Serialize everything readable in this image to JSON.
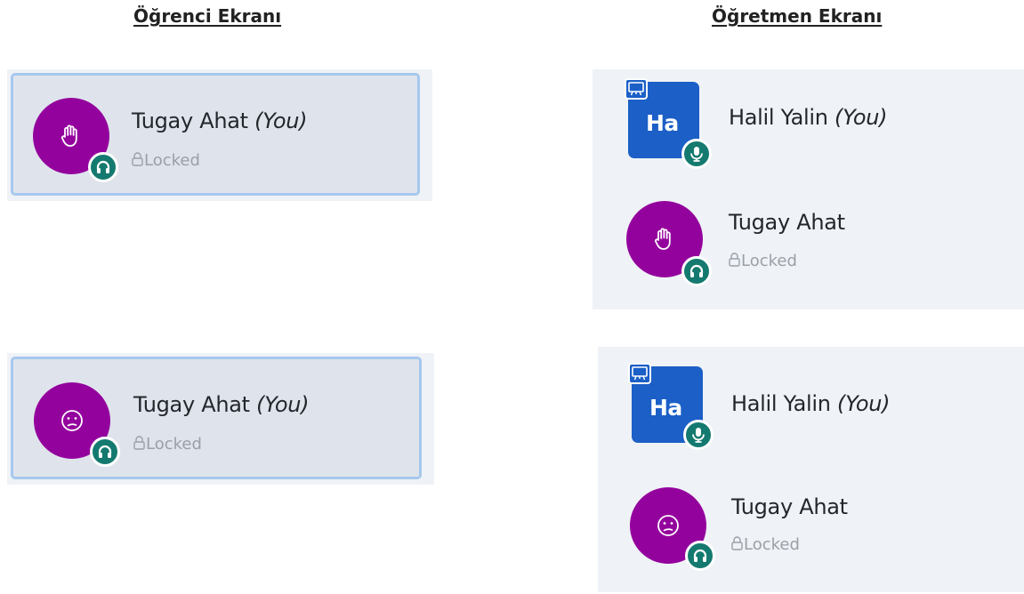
{
  "headings": {
    "student": "Öğrenci Ekranı",
    "teacher": "Öğretmen Ekranı"
  },
  "student_view": {
    "cards": [
      {
        "name": "Tugay Ahat",
        "you_tag": "(You)",
        "status": "Locked",
        "avatar_icon": "raised-hand-icon",
        "badge_icon": "headphones-icon"
      },
      {
        "name": "Tugay Ahat",
        "you_tag": "(You)",
        "status": "Locked",
        "avatar_icon": "confused-face-icon",
        "badge_icon": "headphones-icon"
      }
    ]
  },
  "teacher_view": {
    "panels": [
      {
        "teacher": {
          "initials": "Ha",
          "name": "Halil Yalin",
          "you_tag": "(You)",
          "presenter_icon": "presentation-board-icon",
          "badge_icon": "microphone-icon"
        },
        "student": {
          "name": "Tugay Ahat",
          "status": "Locked",
          "avatar_icon": "raised-hand-icon",
          "badge_icon": "headphones-icon"
        }
      },
      {
        "teacher": {
          "initials": "Ha",
          "name": "Halil Yalin",
          "you_tag": "(You)",
          "presenter_icon": "presentation-board-icon",
          "badge_icon": "microphone-icon"
        },
        "student": {
          "name": "Tugay Ahat",
          "status": "Locked",
          "avatar_icon": "confused-face-icon",
          "badge_icon": "headphones-icon"
        }
      }
    ]
  },
  "colors": {
    "student_avatar": "#94029d",
    "teacher_avatar": "#1b5fc7",
    "status_badge": "#147a70",
    "selected_border": "#a6c8ee",
    "card_background": "#dfe4ec",
    "panel_background": "#eff2f6"
  }
}
